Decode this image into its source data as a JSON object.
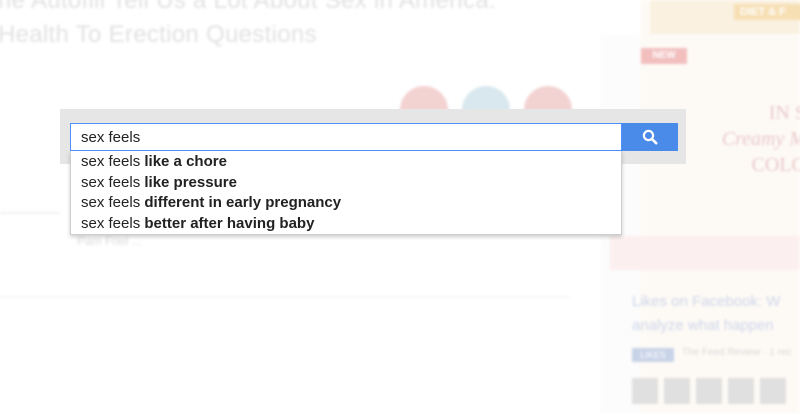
{
  "background": {
    "headline_line1": "ne Autofill Tell Us a Lot About Sex in America:",
    "headline_line2": "Health To Erection Questions",
    "under_text": "Pam Friel ... ",
    "sidebar": {
      "top_button": "DIET & F",
      "new_badge": "NEW",
      "promo_line1": "IN S",
      "promo_line2": "Creamy M",
      "promo_line3": "COLO",
      "story_text": "Likes on Facebook: W analyze what happen",
      "tag": "LIKES",
      "tag_caption": "The Feed Review · 1 rec"
    }
  },
  "search": {
    "query": "sex feels",
    "button_icon": "search-icon",
    "accent_color": "#4a8ae8",
    "suggestions": [
      {
        "prefix": "sex feels ",
        "completion": "like a chore"
      },
      {
        "prefix": "sex feels ",
        "completion": "like pressure"
      },
      {
        "prefix": "sex feels ",
        "completion": "different in early pregnancy"
      },
      {
        "prefix": "sex feels ",
        "completion": "better after having baby"
      }
    ]
  }
}
